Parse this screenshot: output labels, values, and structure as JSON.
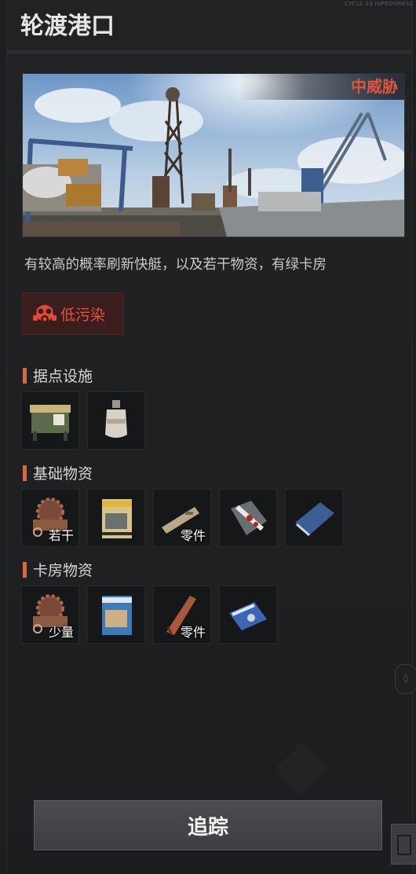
{
  "header": {
    "title": "轮渡港口",
    "version_tag": "CYCLE-23 INPROGRESS"
  },
  "location": {
    "threat_level": "中威胁",
    "description": "有较高的概率刷新快艇，以及若干物资，有绿卡房",
    "pollution_label": "低污染"
  },
  "sections": [
    {
      "title": "据点设施",
      "items": [
        {
          "icon": "supply-crate-icon",
          "qty": ""
        },
        {
          "icon": "gas-canister-icon",
          "qty": ""
        }
      ]
    },
    {
      "title": "基础物资",
      "items": [
        {
          "icon": "scrap-gears-icon",
          "qty": "若干"
        },
        {
          "icon": "confidential-document-icon",
          "qty": ""
        },
        {
          "icon": "weapon-part-icon",
          "qty": "零件"
        },
        {
          "icon": "bloody-puzzle-map-icon",
          "qty": ""
        },
        {
          "icon": "blue-book-icon",
          "qty": ""
        }
      ]
    },
    {
      "title": "卡房物资",
      "items": [
        {
          "icon": "scrap-gears-icon",
          "qty": "少量"
        },
        {
          "icon": "secret-document-icon",
          "qty": ""
        },
        {
          "icon": "wooden-handle-part-icon",
          "qty": "零件"
        },
        {
          "icon": "blue-keycard-icon",
          "qty": ""
        }
      ]
    }
  ],
  "actions": {
    "track_label": "追踪"
  },
  "colors": {
    "threat": "#e2533a",
    "accent_bar": "#d96a3b",
    "pollution_bg": "#3a1e1d"
  }
}
